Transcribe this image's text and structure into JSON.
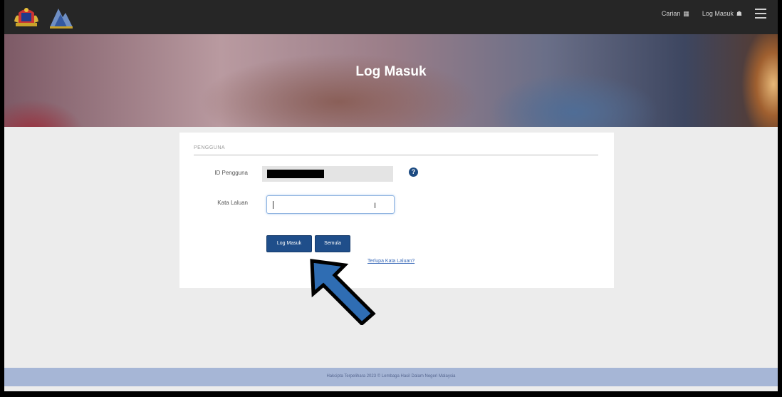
{
  "header": {
    "nav": {
      "help_label": "Carian",
      "login_label": "Log Masuk"
    }
  },
  "hero": {
    "title": "Log Masuk"
  },
  "form": {
    "section_label": "PENGGUNA",
    "user_id_label": "ID Pengguna",
    "password_label": "Kata Laluan",
    "login_button": "Log Masuk",
    "reset_button": "Semula",
    "forgot_link": "Terlupa Kata Laluan?"
  },
  "footer": {
    "text": "Hakcipta Terpelihara 2023 © Lembaga Hasil Dalam Negeri Malaysia"
  },
  "icons": {
    "help": "question-circle-icon",
    "menu": "hamburger-menu-icon",
    "arrow": "pointer-arrow-icon"
  },
  "colors": {
    "primary": "#1f4e8a",
    "topbar": "#262626",
    "footer": "#a6b6d6",
    "arrow": "#2f6db3"
  }
}
